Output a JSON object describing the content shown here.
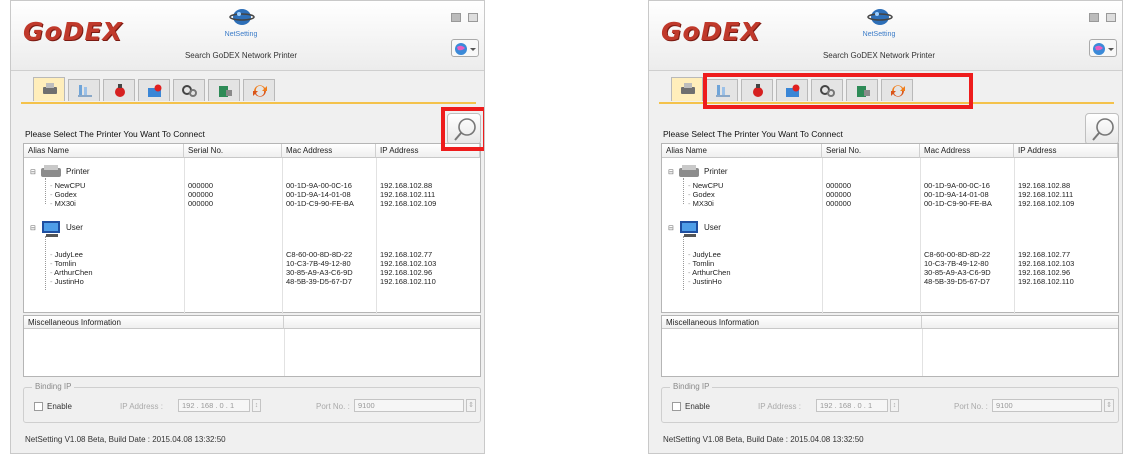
{
  "app": {
    "logo": "GoDEX",
    "product_name": "NetSetting",
    "subtitle": "Search GoDEX Network Printer"
  },
  "tabs": [
    {
      "icon": "printer-icon",
      "active": true
    },
    {
      "icon": "network-icon"
    },
    {
      "icon": "fire-extinguisher-icon"
    },
    {
      "icon": "mail-alert-icon"
    },
    {
      "icon": "gears-icon"
    },
    {
      "icon": "device-settings-icon"
    },
    {
      "icon": "refresh-arrows-icon"
    }
  ],
  "prompt": "Please Select The Printer You Want To Connect",
  "list": {
    "columns": [
      "Alias Name",
      "Serial No.",
      "Mac Address",
      "IP Address"
    ],
    "groups": [
      {
        "label": "Printer",
        "icon": "printer-group-icon",
        "rows": [
          {
            "alias": "NewCPU",
            "serial": "000000",
            "mac": "00-1D-9A-00-0C-16",
            "ip": "192.168.102.88"
          },
          {
            "alias": "Godex",
            "serial": "000000",
            "mac": "00-1D-9A-14-01-08",
            "ip": "192.168.102.111"
          },
          {
            "alias": "MX30i",
            "serial": "000000",
            "mac": "00-1D-C9-90-FE-BA",
            "ip": "192.168.102.109"
          }
        ]
      },
      {
        "label": "User",
        "icon": "computer-user-icon",
        "rows": [
          {
            "alias": "JudyLee",
            "serial": "",
            "mac": "C8-60-00-8D-8D-22",
            "ip": "192.168.102.77"
          },
          {
            "alias": "Tomlin",
            "serial": "",
            "mac": "10-C3-7B-49-12-80",
            "ip": "192.168.102.103"
          },
          {
            "alias": "ArthurChen",
            "serial": "",
            "mac": "30-85-A9-A3-C6-9D",
            "ip": "192.168.102.96"
          },
          {
            "alias": "JustinHo",
            "serial": "",
            "mac": "48-5B-39-D5-67-D7",
            "ip": "192.168.102.110"
          }
        ]
      }
    ]
  },
  "misc": {
    "header": "Miscellaneous Information"
  },
  "binding": {
    "legend": "Binding IP",
    "enable_label": "Enable",
    "ip_label": "IP Address :",
    "ip_value": "192 . 168 . 0 . 1",
    "port_label": "Port No. :",
    "port_value": "9100"
  },
  "status": "NetSetting V1.08 Beta, Build Date : 2015.04.08 13:32:50",
  "highlight_color": "#ee1c1c"
}
